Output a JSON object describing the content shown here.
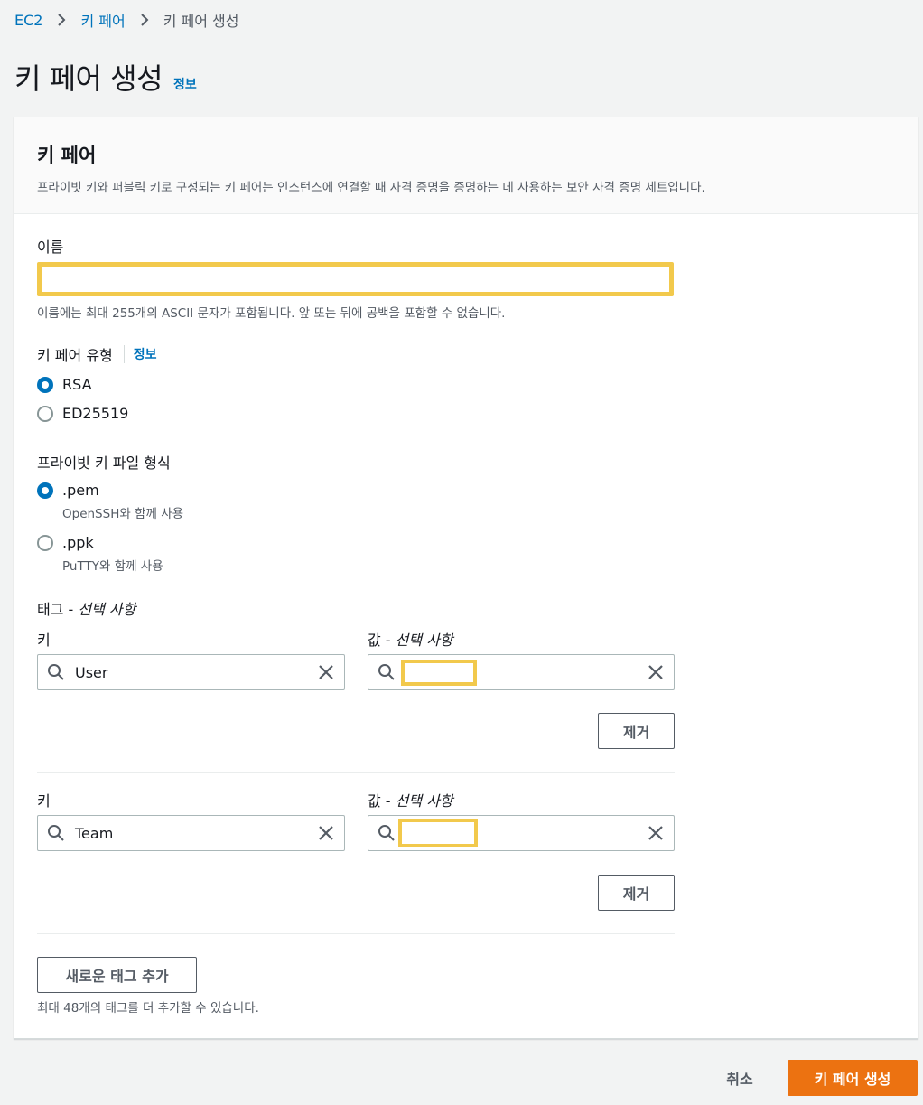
{
  "breadcrumb": {
    "items": [
      "EC2",
      "키 페어",
      "키 페어 생성"
    ]
  },
  "page": {
    "title": "키 페어 생성",
    "info": "정보"
  },
  "panel": {
    "title": "키 페어",
    "description": "프라이빗 키와 퍼블릭 키로 구성되는 키 페어는 인스턴스에 연결할 때 자격 증명을 증명하는 데 사용하는 보안 자격 증명 세트입니다."
  },
  "name_field": {
    "label": "이름",
    "value": "",
    "hint": "이름에는 최대 255개의 ASCII 문자가 포함됩니다. 앞 또는 뒤에 공백을 포함할 수 없습니다."
  },
  "key_pair_type": {
    "label": "키 페어 유형",
    "info": "정보",
    "options": [
      {
        "label": "RSA",
        "checked": true
      },
      {
        "label": "ED25519",
        "checked": false
      }
    ]
  },
  "private_key_format": {
    "label": "프라이빗 키 파일 형식",
    "options": [
      {
        "label": ".pem",
        "sub": "OpenSSH와 함께 사용",
        "checked": true
      },
      {
        "label": ".ppk",
        "sub": "PuTTY와 함께 사용",
        "checked": false
      }
    ]
  },
  "tags": {
    "title_prefix": "태그 - ",
    "title_optional": "선택 사항",
    "key_label": "키",
    "value_label_prefix": "값 - ",
    "value_label_optional": "선택 사항",
    "remove_label": "제거",
    "rows": [
      {
        "key": "User",
        "value": ""
      },
      {
        "key": "Team",
        "value": ""
      }
    ],
    "add_label": "새로운 태그 추가",
    "add_hint": "최대 48개의 태그를 더 추가할 수 있습니다."
  },
  "footer": {
    "cancel_label": "취소",
    "create_label": "키 페어 생성"
  },
  "colors": {
    "link": "#0073bb",
    "primary": "#ec7211",
    "highlight": "#f2c94c"
  }
}
